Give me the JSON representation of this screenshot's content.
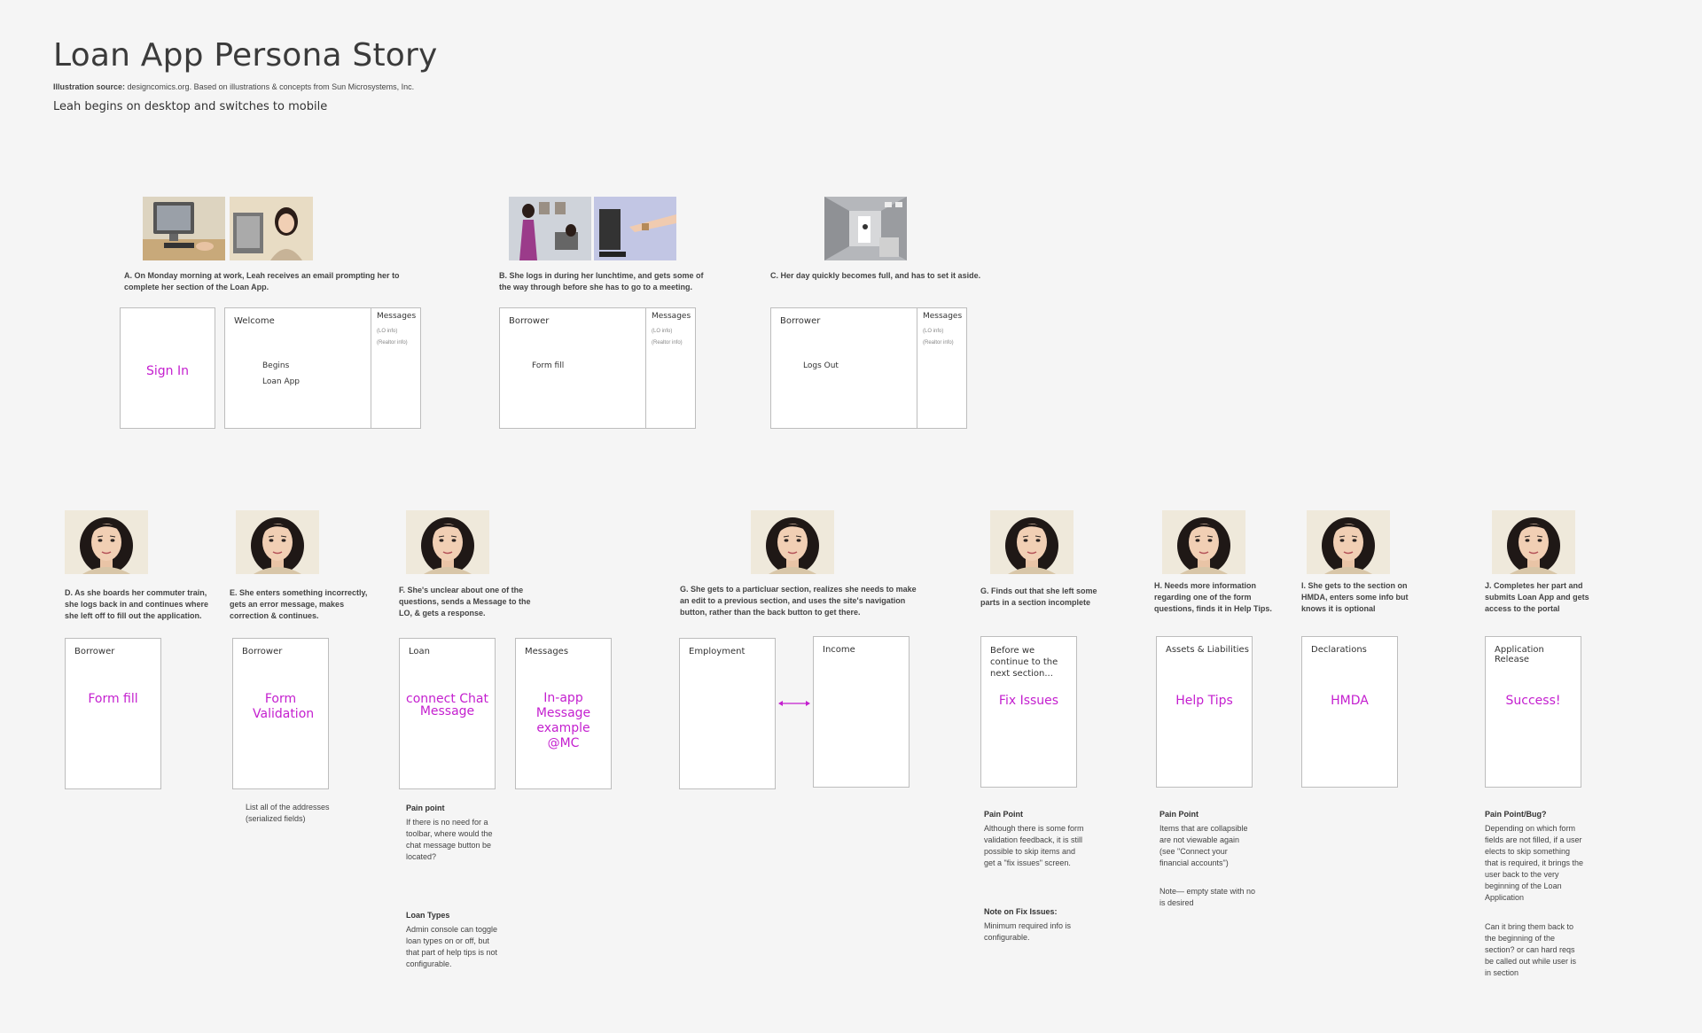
{
  "header": {
    "title": "Loan App Persona Story",
    "source_label": "Illustration source:",
    "source_text": "designcomics.org. Based on illustrations & concepts from Sun Microsystems, Inc.",
    "subtitle": "Leah begins on desktop and switches to mobile"
  },
  "row1": {
    "A": {
      "caption": "A. On Monday morning at work, Leah receives an email prompting her to complete her section of the Loan App.",
      "signin": "Sign In",
      "welcome": "Welcome",
      "begins": "Begins",
      "loan_app": "Loan App",
      "messages": "Messages",
      "lo_info": "(LO info)",
      "realtor_info": "(Realtor info)"
    },
    "B": {
      "caption": "B. She logs in during her lunchtime, and gets some of the way through before she has to go to a meeting.",
      "borrower": "Borrower",
      "form_fill": "Form fill",
      "messages": "Messages",
      "lo_info": "(LO info)",
      "realtor_info": "(Realtor info)"
    },
    "C": {
      "caption": "C. Her day quickly becomes full, and has to set it aside.",
      "borrower": "Borrower",
      "logs_out": "Logs Out",
      "messages": "Messages",
      "lo_info": "(LO info)",
      "realtor_info": "(Realtor info)"
    }
  },
  "row2": {
    "D": {
      "caption": "D. As she boards her commuter train, she logs back in and continues where she left off to fill out the application.",
      "label": "Borrower",
      "big": "Form fill"
    },
    "E": {
      "caption": "E. She enters something incorrectly, gets an error message, makes correction & continues.",
      "label": "Borrower",
      "big": "Form Validation",
      "note": "List all of the addresses (serialized fields)"
    },
    "F": {
      "caption": "F. She's unclear about one of the questions, sends a Message to the LO, & gets a response.",
      "label": "Loan",
      "big": "connect Chat Message",
      "label2": "Messages",
      "big2": "In-app Message example @MC",
      "note1_head": "Pain point",
      "note1": "If there is no need for a toolbar, where would the chat message button be located?",
      "note2_head": "Loan Types",
      "note2": "Admin console can toggle loan types on or off, but that part of help tips is not configurable."
    },
    "G": {
      "caption": "G. She gets to a particluar section, realizes she needs to make an edit to a previous section, and uses the site's navigation button, rather than the back button to get there.",
      "label": "Employment",
      "label2": "Income"
    },
    "G2": {
      "caption": "G. Finds out that she left some parts in a section incomplete",
      "label": "Before we continue to the next section...",
      "big": "Fix Issues",
      "note1_head": "Pain Point",
      "note1": "Although there is some form validation feedback, it is still possible to skip items and get a \"fix issues\" screen.",
      "note2_head": "Note on Fix Issues:",
      "note2": "Minimum required info is configurable."
    },
    "H": {
      "caption": "H. Needs more information regarding one of the form questions, finds it in Help Tips.",
      "label": "Assets & Liabilities",
      "big": "Help Tips",
      "note1_head": "Pain Point",
      "note1": "Items that are collapsible are not viewable again (see \"Connect your financial accounts\")",
      "note2": "Note— empty state with no is desired"
    },
    "I": {
      "caption": "I. She gets to the section on HMDA, enters some info but knows it is optional",
      "label": "Declarations",
      "big": "HMDA"
    },
    "J": {
      "caption": "J. Completes her part and submits Loan App and gets access to the portal",
      "label": "Application Release",
      "big": "Success!",
      "note1_head": "Pain Point/Bug?",
      "note1": "Depending on which form fields are not filled, if a user elects to skip something that is required, it brings the user back to the very beginning of the Loan Application",
      "note2": "Can it bring them back to the beginning of the section? or can hard reqs be called out while user is in section"
    }
  },
  "colors": {
    "accent": "#c41fcf",
    "background": "#f5f5f5",
    "border": "#bdbdbd"
  }
}
